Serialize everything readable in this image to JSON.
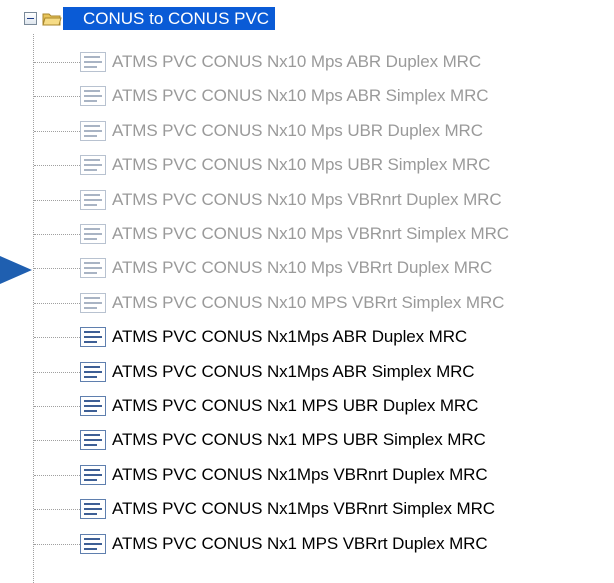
{
  "tree": {
    "root": {
      "label": "CONUS to CONUS PVC",
      "expanded": true,
      "selected": true
    },
    "children": [
      {
        "label": "ATMS PVC CONUS Nx10 Mps ABR Duplex MRC",
        "enabled": false
      },
      {
        "label": "ATMS PVC CONUS Nx10 Mps ABR Simplex MRC",
        "enabled": false
      },
      {
        "label": "ATMS PVC CONUS Nx10 Mps UBR Duplex MRC",
        "enabled": false
      },
      {
        "label": "ATMS PVC CONUS Nx10 Mps UBR Simplex MRC",
        "enabled": false
      },
      {
        "label": "ATMS PVC CONUS Nx10 Mps VBRnrt Duplex MRC",
        "enabled": false
      },
      {
        "label": "ATMS PVC CONUS Nx10 Mps VBRnrt Simplex MRC",
        "enabled": false
      },
      {
        "label": "ATMS PVC CONUS Nx10 Mps VBRrt Duplex MRC",
        "enabled": false
      },
      {
        "label": "ATMS PVC CONUS Nx10 MPS VBRrt Simplex MRC",
        "enabled": false
      },
      {
        "label": "ATMS PVC CONUS Nx1Mps ABR Duplex MRC",
        "enabled": true
      },
      {
        "label": "ATMS PVC CONUS Nx1Mps ABR Simplex MRC",
        "enabled": true
      },
      {
        "label": "ATMS PVC CONUS Nx1 MPS UBR Duplex MRC",
        "enabled": true
      },
      {
        "label": "ATMS PVC CONUS Nx1 MPS UBR Simplex MRC",
        "enabled": true
      },
      {
        "label": "ATMS PVC CONUS Nx1Mps VBRnrt Duplex MRC",
        "enabled": true
      },
      {
        "label": "ATMS PVC CONUS Nx1Mps VBRnrt Simplex MRC",
        "enabled": true
      },
      {
        "label": "ATMS PVC CONUS Nx1 MPS VBRrt Duplex MRC",
        "enabled": true
      }
    ]
  },
  "icons": {
    "expander": "minus-box-icon",
    "root": "open-folder-icon",
    "child": "document-list-icon",
    "pointer": "pointer-arrow-icon"
  },
  "colors": {
    "selection": "#0a5bd6",
    "disabled_text": "#9a9a9a",
    "enabled_text": "#000000",
    "pointer": "#1f5fb0"
  }
}
